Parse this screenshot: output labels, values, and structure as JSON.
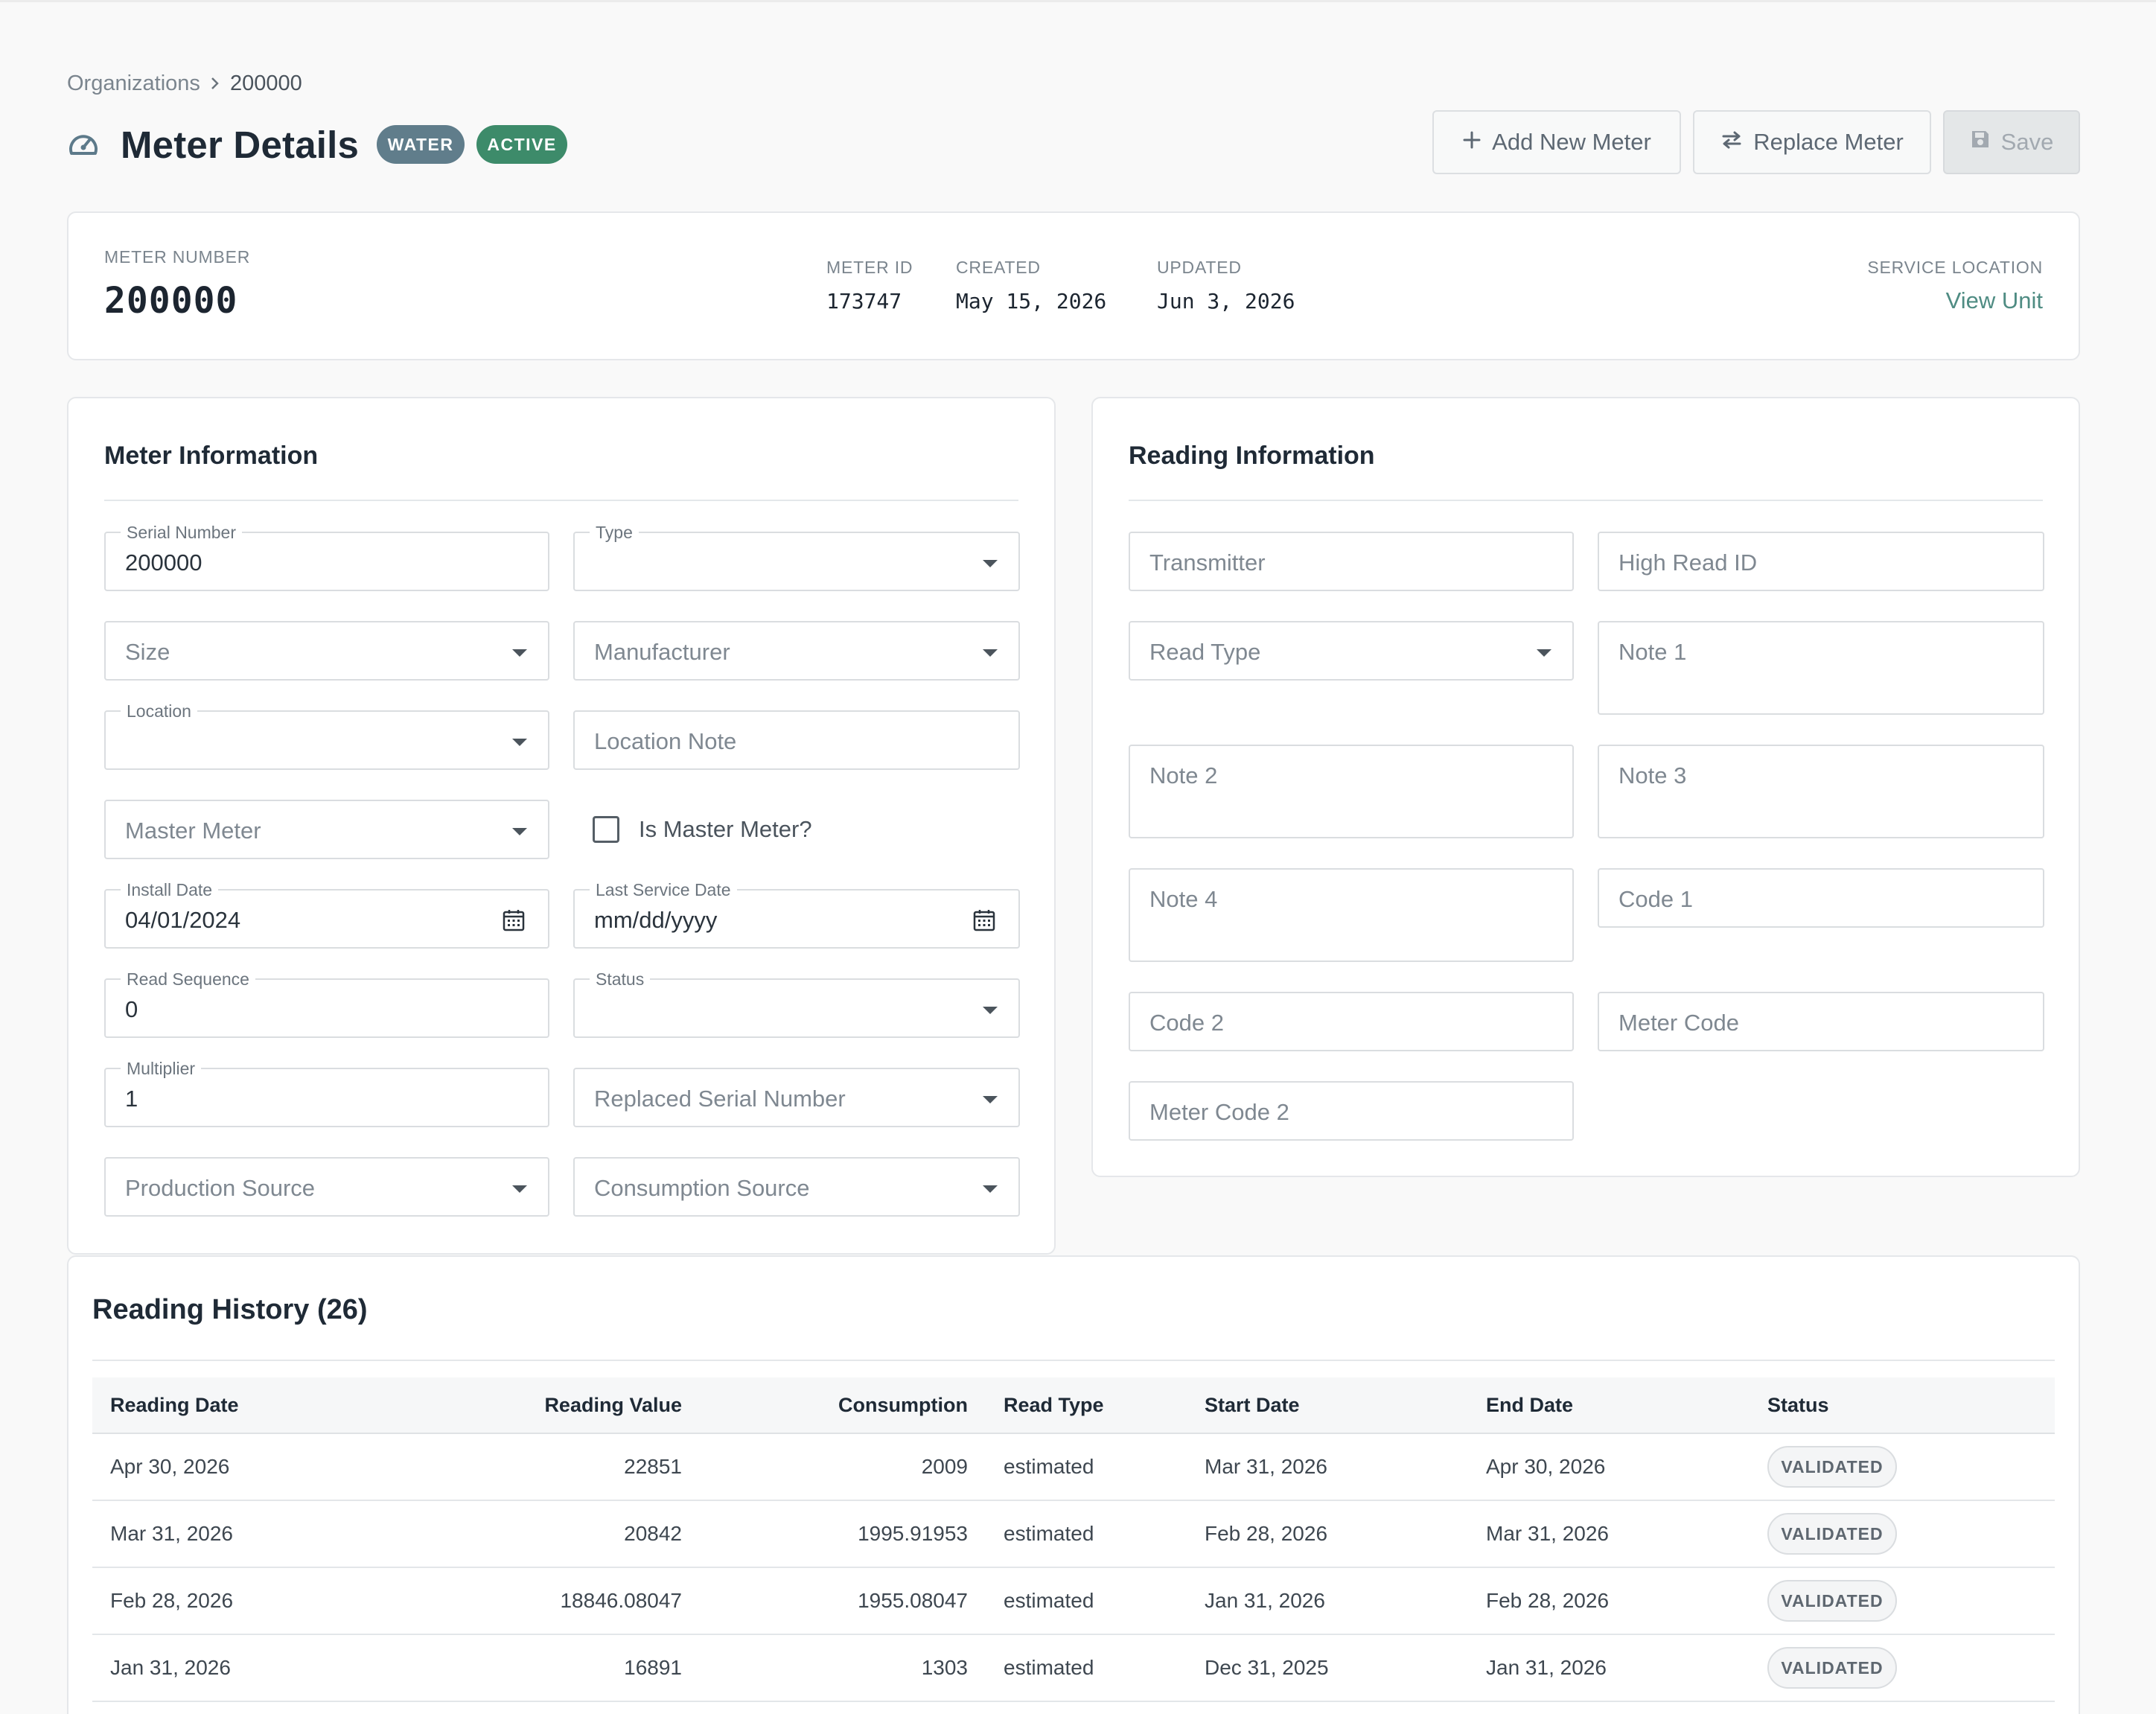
{
  "breadcrumb": {
    "root": "Organizations",
    "current": "200000"
  },
  "header": {
    "title": "Meter Details",
    "badges": {
      "type": "WATER",
      "status": "ACTIVE"
    },
    "badge_colors": {
      "water": "#607d8b",
      "active": "#3d8b6a"
    },
    "actions": {
      "add_new_meter": "Add New Meter",
      "replace_meter": "Replace Meter",
      "save": "Save"
    }
  },
  "summary": {
    "meter_number_label": "METER NUMBER",
    "meter_number": "200000",
    "meter_id_label": "METER ID",
    "meter_id": "173747",
    "created_label": "CREATED",
    "created": "May 15, 2026",
    "updated_label": "UPDATED",
    "updated": "Jun 3, 2026",
    "service_location_label": "SERVICE LOCATION",
    "view_unit": "View Unit"
  },
  "meter_info": {
    "title": "Meter Information",
    "serial_number": {
      "label": "Serial Number",
      "value": "200000"
    },
    "type": {
      "label": "Type",
      "value": ""
    },
    "size": {
      "placeholder": "Size"
    },
    "manufacturer": {
      "placeholder": "Manufacturer"
    },
    "location": {
      "label": "Location",
      "value": ""
    },
    "location_note": {
      "placeholder": "Location Note"
    },
    "master_meter": {
      "placeholder": "Master Meter"
    },
    "is_master_meter": {
      "label": "Is Master Meter?",
      "checked": false
    },
    "install_date": {
      "label": "Install Date",
      "value": "04/01/2024"
    },
    "last_service_date": {
      "label": "Last Service Date",
      "value": "mm/dd/yyyy"
    },
    "read_sequence": {
      "label": "Read Sequence",
      "value": "0"
    },
    "status": {
      "label": "Status",
      "value": ""
    },
    "multiplier": {
      "label": "Multiplier",
      "value": "1"
    },
    "replaced_serial_number": {
      "placeholder": "Replaced Serial Number"
    },
    "production_source": {
      "placeholder": "Production Source"
    },
    "consumption_source": {
      "placeholder": "Consumption Source"
    }
  },
  "reading_info": {
    "title": "Reading Information",
    "transmitter": "Transmitter",
    "high_read_id": "High Read ID",
    "read_type": "Read Type",
    "note1": "Note 1",
    "note2": "Note 2",
    "note3": "Note 3",
    "note4": "Note 4",
    "code1": "Code 1",
    "code2": "Code 2",
    "meter_code": "Meter Code",
    "meter_code2": "Meter Code 2"
  },
  "history": {
    "title": "Reading History (26)",
    "columns": [
      "Reading Date",
      "Reading Value",
      "Consumption",
      "Read Type",
      "Start Date",
      "End Date",
      "Status"
    ],
    "rows": [
      [
        "Apr 30, 2026",
        "22851",
        "2009",
        "estimated",
        "Mar 31, 2026",
        "Apr 30, 2026",
        "VALIDATED"
      ],
      [
        "Mar 31, 2026",
        "20842",
        "1995.91953",
        "estimated",
        "Feb 28, 2026",
        "Mar 31, 2026",
        "VALIDATED"
      ],
      [
        "Feb 28, 2026",
        "18846.08047",
        "1955.08047",
        "estimated",
        "Jan 31, 2026",
        "Feb 28, 2026",
        "VALIDATED"
      ],
      [
        "Jan 31, 2026",
        "16891",
        "1303",
        "estimated",
        "Dec 31, 2025",
        "Jan 31, 2026",
        "VALIDATED"
      ]
    ]
  }
}
